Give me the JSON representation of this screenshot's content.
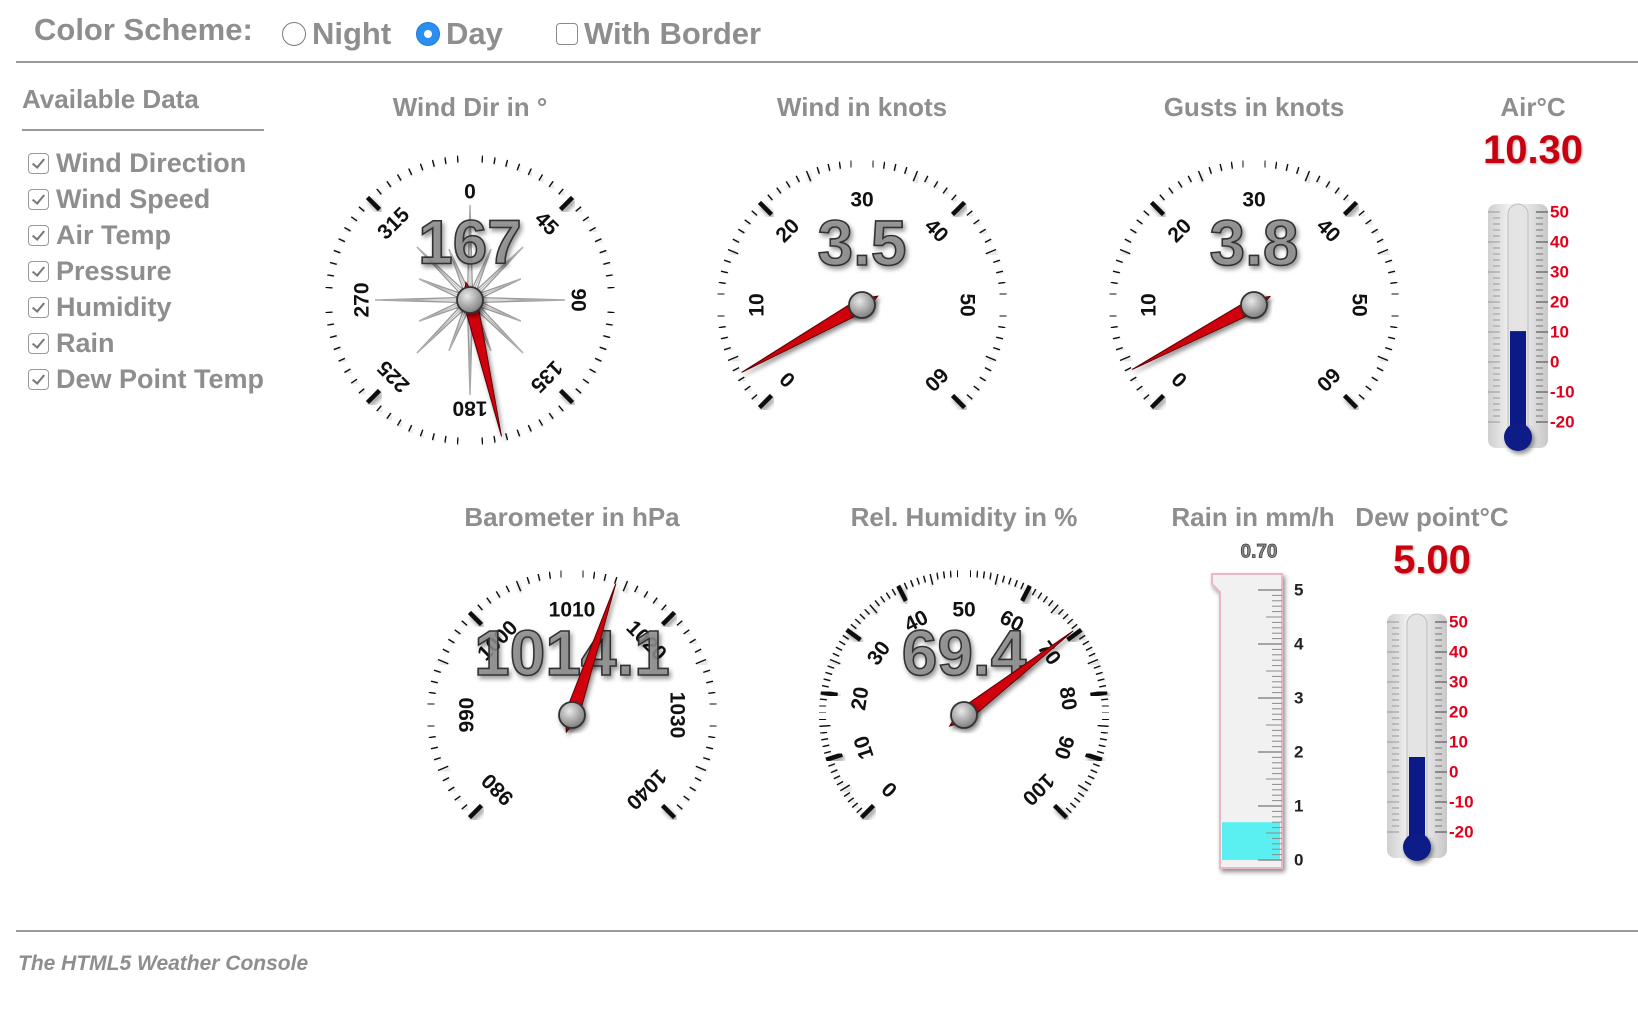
{
  "header": {
    "color_scheme_label": "Color Scheme:",
    "options": [
      {
        "label": "Night",
        "selected": false
      },
      {
        "label": "Day",
        "selected": true
      }
    ],
    "border_option": {
      "label": "With Border",
      "checked": false
    }
  },
  "sidebar": {
    "title": "Available Data",
    "items": [
      {
        "label": "Wind Direction",
        "checked": true
      },
      {
        "label": "Wind Speed",
        "checked": true
      },
      {
        "label": "Air Temp",
        "checked": true
      },
      {
        "label": "Pressure",
        "checked": true
      },
      {
        "label": "Humidity",
        "checked": true
      },
      {
        "label": "Rain",
        "checked": true
      },
      {
        "label": "Dew Point Temp",
        "checked": true
      }
    ]
  },
  "gauges": {
    "wind_dir": {
      "title": "Wind Dir in °",
      "value": 167,
      "display": "167",
      "labels": [
        "0",
        "45",
        "90",
        "135",
        "180",
        "225",
        "270",
        "315"
      ]
    },
    "wind_speed": {
      "title": "Wind in knots",
      "value": 3.5,
      "display": "3.5",
      "min": 0,
      "max": 60,
      "labels": [
        "0",
        "10",
        "20",
        "30",
        "40",
        "50",
        "60"
      ]
    },
    "gusts": {
      "title": "Gusts in knots",
      "value": 3.8,
      "display": "3.8",
      "min": 0,
      "max": 60,
      "labels": [
        "0",
        "10",
        "20",
        "30",
        "40",
        "50",
        "60"
      ]
    },
    "barometer": {
      "title": "Barometer in hPa",
      "value": 1014.1,
      "display": "1014.1",
      "min": 980,
      "max": 1040,
      "labels": [
        "980",
        "990",
        "1000",
        "1010",
        "1020",
        "1030",
        "1040"
      ]
    },
    "humidity": {
      "title": "Rel. Humidity in %",
      "value": 69.4,
      "display": "69.4",
      "min": 0,
      "max": 100,
      "labels": [
        "0",
        "10",
        "20",
        "30",
        "40",
        "50",
        "60",
        "70",
        "80",
        "90",
        "100"
      ]
    }
  },
  "thermometers": {
    "air": {
      "title": "Air°C",
      "value": 10.3,
      "display": "10.30",
      "min": -20,
      "max": 50,
      "labels": [
        "50",
        "40",
        "30",
        "20",
        "10",
        "0",
        "-10",
        "-20"
      ]
    },
    "dew": {
      "title": "Dew point°C",
      "value": 5.0,
      "display": "5.00",
      "min": -20,
      "max": 50,
      "labels": [
        "50",
        "40",
        "30",
        "20",
        "10",
        "0",
        "-10",
        "-20"
      ]
    }
  },
  "rain": {
    "title": "Rain in mm/h",
    "value": 0.7,
    "display": "0.70",
    "min": 0,
    "max": 5,
    "labels": [
      "5",
      "4",
      "3",
      "2",
      "1",
      "0"
    ]
  },
  "footer": {
    "text": "The HTML5 Weather Console"
  },
  "colors": {
    "needle": "#d10010",
    "thermo_fill": "#0b1a86",
    "rain_fill": "#3ff0f2",
    "thermo_label": "#e0001b",
    "accent_radio": "#2a8ff0"
  }
}
